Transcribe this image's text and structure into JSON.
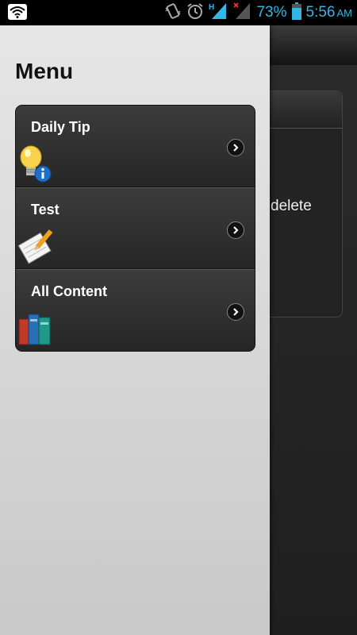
{
  "status_bar": {
    "battery_percent": "73%",
    "time": "5:56",
    "ampm": "AM",
    "network_type": "H",
    "icons": [
      "wifi-icon",
      "vibrate-icon",
      "alarm-icon",
      "signal-icon",
      "signal-no-data-icon",
      "battery-icon"
    ]
  },
  "background": {
    "partial_text": "delete"
  },
  "drawer": {
    "title": "Menu",
    "items": [
      {
        "label": "Daily Tip",
        "icon": "lightbulb-info-icon"
      },
      {
        "label": "Test",
        "icon": "notepad-pencil-icon"
      },
      {
        "label": "All Content",
        "icon": "books-icon"
      }
    ]
  },
  "colors": {
    "status_accent": "#33b5e5",
    "drawer_bg": "#d9d9d9",
    "menu_bg": "#2e2e2e"
  }
}
